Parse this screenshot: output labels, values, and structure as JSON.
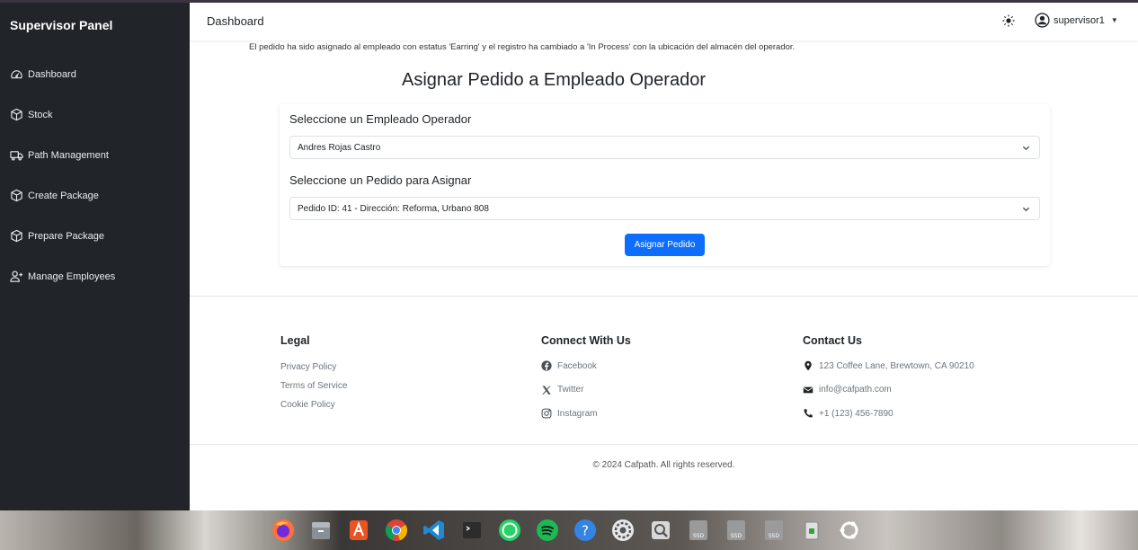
{
  "sidebar": {
    "title": "Supervisor Panel",
    "items": [
      {
        "label": "Dashboard",
        "icon": "speedometer-icon"
      },
      {
        "label": "Stock",
        "icon": "box-icon"
      },
      {
        "label": "Path Management",
        "icon": "truck-icon"
      },
      {
        "label": "Create Package",
        "icon": "box-icon"
      },
      {
        "label": "Prepare Package",
        "icon": "box-icon"
      },
      {
        "label": "Manage Employees",
        "icon": "person-plus-icon"
      }
    ]
  },
  "header": {
    "title": "Dashboard",
    "user": "supervisor1"
  },
  "alert": {
    "message": "El pedido ha sido asignado al empleado con estatus 'Earring' y el registro ha cambiado a 'In Process' con la ubicación del almacén del operador."
  },
  "main": {
    "title": "Asignar Pedido a Empleado Operador",
    "employee_label": "Seleccione un Empleado Operador",
    "employee_selected": "Andres Rojas Castro",
    "order_label": "Seleccione un Pedido para Asignar",
    "order_selected": "Pedido ID: 41 - Dirección: Reforma, Urbano 808",
    "submit_label": "Asignar Pedido"
  },
  "footer": {
    "legal": {
      "heading": "Legal",
      "links": [
        "Privacy Policy",
        "Terms of Service",
        "Cookie Policy"
      ]
    },
    "connect": {
      "heading": "Connect With Us",
      "links": [
        "Facebook",
        "Twitter",
        "Instagram"
      ]
    },
    "contact": {
      "heading": "Contact Us",
      "address": "123 Coffee Lane, Brewtown, CA 90210",
      "email": "info@cafpath.com",
      "phone": "+1 (123) 456-7890"
    },
    "copyright": "© 2024 Cafpath. All rights reserved."
  },
  "dock": {
    "apps": [
      "firefox-icon",
      "files-icon",
      "app-center-icon",
      "chrome-icon",
      "vscode-icon",
      "terminal-icon",
      "whatsapp-icon",
      "spotify-icon",
      "help-icon",
      "settings-icon",
      "image-viewer-icon",
      "ssd-drive-icon",
      "ssd-drive-icon",
      "ssd-drive-icon",
      "trash-icon",
      "ubuntu-icon"
    ],
    "ssd_label": "SSD"
  },
  "colors": {
    "sidebar_bg": "#212529",
    "primary": "#0d6efd",
    "muted_text": "#6c757d"
  }
}
